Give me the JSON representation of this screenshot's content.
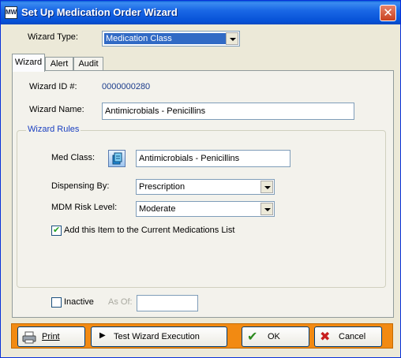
{
  "window": {
    "title": "Set Up Medication Order Wizard",
    "app_icon_text": "MW"
  },
  "wizard_type": {
    "label": "Wizard Type:",
    "value": "Medication Class"
  },
  "tabs": [
    {
      "label": "Wizard"
    },
    {
      "label": "Alert"
    },
    {
      "label": "Audit"
    }
  ],
  "wizard_tab": {
    "id_label": "Wizard ID #:",
    "id_value": "0000000280",
    "name_label": "Wizard Name:",
    "name_value": "Antimicrobials - Penicillins",
    "rules": {
      "title": "Wizard Rules",
      "med_class_label": "Med Class:",
      "med_class_value": "Antimicrobials - Penicillins",
      "dispensing_label": "Dispensing By:",
      "dispensing_value": "Prescription",
      "risk_label": "MDM Risk Level:",
      "risk_value": "Moderate",
      "add_current_label": "Add this Item to the Current Medications List",
      "add_current_checked": true
    },
    "inactive_label": "Inactive",
    "inactive_checked": false,
    "as_of_label": "As Of:",
    "as_of_value": ""
  },
  "buttons": {
    "print": "Print",
    "test": "Test Wizard Execution",
    "ok": "OK",
    "cancel": "Cancel"
  },
  "colors": {
    "accent_bar": "#f28a12",
    "link_blue": "#1a3fc0",
    "id_blue": "#1b3c8c"
  }
}
